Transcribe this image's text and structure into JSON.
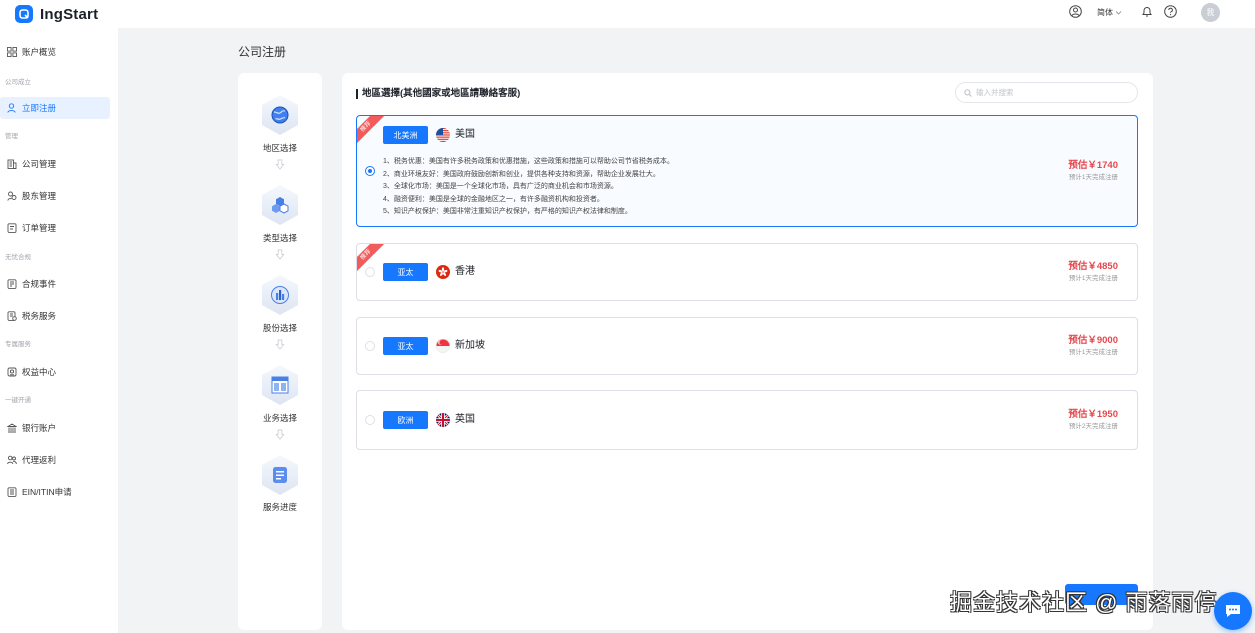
{
  "app": {
    "name": "IngStart"
  },
  "colors": {
    "brand": "#1677ff",
    "price": "#e5484d",
    "ribbon": "#f15b5b"
  },
  "header": {
    "language": "简体",
    "avatar_text": "我",
    "icons": [
      "user-circle-icon",
      "chevron-down-icon",
      "bell-icon",
      "help-icon"
    ]
  },
  "sidebar": {
    "top_item": {
      "label": "账户概览",
      "icon": "grid-icon"
    },
    "sections": [
      {
        "title": "公司成立",
        "items": [
          {
            "label": "立即注册",
            "icon": "user-icon",
            "active": true
          }
        ]
      },
      {
        "title": "管理",
        "items": [
          {
            "label": "公司管理",
            "icon": "building-icon"
          },
          {
            "label": "股东管理",
            "icon": "shareholder-icon"
          },
          {
            "label": "订单管理",
            "icon": "order-icon"
          }
        ]
      },
      {
        "title": "无忧合规",
        "items": [
          {
            "label": "合规事件",
            "icon": "compliance-icon"
          },
          {
            "label": "税务服务",
            "icon": "tax-icon"
          }
        ]
      },
      {
        "title": "专属服务",
        "items": [
          {
            "label": "权益中心",
            "icon": "benefits-icon"
          }
        ]
      },
      {
        "title": "一键开通",
        "items": [
          {
            "label": "银行账户",
            "icon": "bank-icon"
          },
          {
            "label": "代理返利",
            "icon": "rebate-icon"
          },
          {
            "label": "EIN/ITIN申请",
            "icon": "ein-icon"
          }
        ]
      }
    ]
  },
  "page": {
    "title": "公司注册"
  },
  "steps": [
    {
      "label": "地区选择",
      "icon": "globe-icon",
      "active": true
    },
    {
      "label": "类型选择",
      "icon": "cubes-icon"
    },
    {
      "label": "股份选择",
      "icon": "chart-icon"
    },
    {
      "label": "业务选择",
      "icon": "layout-icon"
    },
    {
      "label": "服务进度",
      "icon": "document-icon"
    }
  ],
  "region": {
    "title": "地區選擇(其他國家或地區請聯絡客服)",
    "search_placeholder": "输入并搜索",
    "options": [
      {
        "badge": "推荐",
        "selected": true,
        "tag": "北美洲",
        "country": "美国",
        "flag": "us-flag-icon",
        "price": "预估￥1740",
        "eta": "预计1天完成注册",
        "description": [
          "1、税务优惠：美国有许多税务政策和优惠措施，这些政策和措施可以帮助公司节省税务成本。",
          "2、商业环境友好：美国政府鼓励创新和创业，提供各种支持和资源，帮助企业发展壮大。",
          "3、全球化市场：美国是一个全球化市场，具有广泛的商业机会和市场资源。",
          "4、融资便利：美国是全球的金融地区之一，有许多融资机构和投资者。",
          "5、知识产权保护：美国非常注重知识产权保护，有严格的知识产权法律和制度。"
        ]
      },
      {
        "badge": "推荐",
        "tag": "亚太",
        "country": "香港",
        "flag": "hongkong-flag-icon",
        "price": "预估￥4850",
        "eta": "预计1天完成注册"
      },
      {
        "tag": "亚太",
        "country": "新加坡",
        "flag": "singapore-flag-icon",
        "price": "预估￥9000",
        "eta": "预计1天完成注册"
      },
      {
        "tag": "欧洲",
        "country": "英国",
        "flag": "uk-flag-icon",
        "price": "预估￥1950",
        "eta": "预计2天完成注册"
      }
    ]
  },
  "watermark": "掘金技术社区 @ 雨落雨停"
}
